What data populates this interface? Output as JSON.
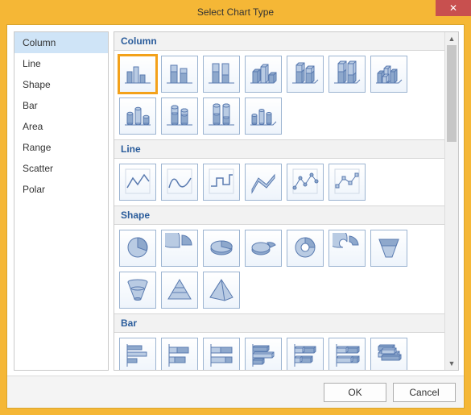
{
  "window": {
    "title": "Select Chart Type",
    "close": "✕"
  },
  "sidebar": {
    "items": [
      {
        "label": "Column",
        "selected": true
      },
      {
        "label": "Line",
        "selected": false
      },
      {
        "label": "Shape",
        "selected": false
      },
      {
        "label": "Bar",
        "selected": false
      },
      {
        "label": "Area",
        "selected": false
      },
      {
        "label": "Range",
        "selected": false
      },
      {
        "label": "Scatter",
        "selected": false
      },
      {
        "label": "Polar",
        "selected": false
      }
    ]
  },
  "groups": [
    {
      "label": "Column",
      "tiles": [
        {
          "name": "column-clustered",
          "icon": "col2d",
          "selected": true
        },
        {
          "name": "column-stacked",
          "icon": "colstack",
          "selected": false
        },
        {
          "name": "column-100-stacked",
          "icon": "col100",
          "selected": false
        },
        {
          "name": "column-3d-clustered",
          "icon": "col3d",
          "selected": false
        },
        {
          "name": "column-3d-stacked",
          "icon": "col3dstack",
          "selected": false
        },
        {
          "name": "column-3d-100-stacked",
          "icon": "col3d100",
          "selected": false
        },
        {
          "name": "column-3d",
          "icon": "col3dfull",
          "selected": false
        },
        {
          "name": "cylinder-clustered",
          "icon": "cyl",
          "selected": false
        },
        {
          "name": "cylinder-stacked",
          "icon": "cylstack",
          "selected": false
        },
        {
          "name": "cylinder-100-stacked",
          "icon": "cyl100",
          "selected": false
        },
        {
          "name": "cylinder-3d",
          "icon": "cyl3d",
          "selected": false
        }
      ]
    },
    {
      "label": "Line",
      "tiles": [
        {
          "name": "line",
          "icon": "line",
          "selected": false
        },
        {
          "name": "line-smooth",
          "icon": "linesm",
          "selected": false
        },
        {
          "name": "step-line",
          "icon": "step",
          "selected": false
        },
        {
          "name": "line-3d",
          "icon": "line3d",
          "selected": false
        },
        {
          "name": "line-markers",
          "icon": "linepts",
          "selected": false
        },
        {
          "name": "line-markers-box",
          "icon": "linebox",
          "selected": false
        }
      ]
    },
    {
      "label": "Shape",
      "tiles": [
        {
          "name": "pie",
          "icon": "pie",
          "selected": false
        },
        {
          "name": "pie-exploded",
          "icon": "pieexp",
          "selected": false
        },
        {
          "name": "pie-3d",
          "icon": "pie3d",
          "selected": false
        },
        {
          "name": "pie-3d-exploded",
          "icon": "pie3dexp",
          "selected": false
        },
        {
          "name": "doughnut",
          "icon": "donut",
          "selected": false
        },
        {
          "name": "doughnut-split",
          "icon": "donutexp",
          "selected": false
        },
        {
          "name": "funnel",
          "icon": "funnel",
          "selected": false
        },
        {
          "name": "funnel-3d",
          "icon": "funnel3d",
          "selected": false
        },
        {
          "name": "pyramid",
          "icon": "pyramid",
          "selected": false
        },
        {
          "name": "pyramid-3d",
          "icon": "pyr3d",
          "selected": false
        }
      ]
    },
    {
      "label": "Bar",
      "tiles": [
        {
          "name": "bar-clustered",
          "icon": "bar",
          "selected": false
        },
        {
          "name": "bar-stacked",
          "icon": "barstack",
          "selected": false
        },
        {
          "name": "bar-100-stacked",
          "icon": "bar100",
          "selected": false
        },
        {
          "name": "bar-3d-clustered",
          "icon": "bar3d",
          "selected": false
        },
        {
          "name": "bar-3d-stacked",
          "icon": "bar3dst",
          "selected": false
        },
        {
          "name": "bar-3d-100-stacked",
          "icon": "bar3d100",
          "selected": false
        },
        {
          "name": "bar-3d",
          "icon": "bar3df",
          "selected": false
        }
      ]
    }
  ],
  "footer": {
    "ok": "OK",
    "cancel": "Cancel"
  },
  "colors": {
    "accent": "#f5b736",
    "iconFill": "#8ea8cc",
    "iconFillLight": "#b9cbe3",
    "iconStroke": "#5a7bb0",
    "selected": "#f3a11a"
  }
}
